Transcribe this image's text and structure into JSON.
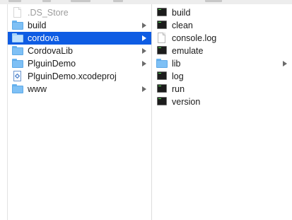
{
  "columns": {
    "parent": {
      "items": [
        {
          "label": ".DS_Store",
          "icon": "document-icon",
          "kind": "file",
          "dimmed": true
        },
        {
          "label": "build",
          "icon": "folder-icon",
          "kind": "folder"
        },
        {
          "label": "cordova",
          "icon": "folder-icon",
          "kind": "folder",
          "selected": true
        },
        {
          "label": "CordovaLib",
          "icon": "folder-icon",
          "kind": "folder"
        },
        {
          "label": "PlguinDemo",
          "icon": "folder-icon",
          "kind": "folder"
        },
        {
          "label": "PlguinDemo.xcodeproj",
          "icon": "xcodeproj-icon",
          "kind": "file"
        },
        {
          "label": "www",
          "icon": "folder-icon",
          "kind": "folder"
        }
      ]
    },
    "contents": {
      "items": [
        {
          "label": "build",
          "icon": "terminal-executable-icon",
          "kind": "file"
        },
        {
          "label": "clean",
          "icon": "terminal-executable-icon",
          "kind": "file"
        },
        {
          "label": "console.log",
          "icon": "document-icon",
          "kind": "file"
        },
        {
          "label": "emulate",
          "icon": "terminal-executable-icon",
          "kind": "file"
        },
        {
          "label": "lib",
          "icon": "folder-icon",
          "kind": "folder"
        },
        {
          "label": "log",
          "icon": "terminal-executable-icon",
          "kind": "file"
        },
        {
          "label": "run",
          "icon": "terminal-executable-icon",
          "kind": "file"
        },
        {
          "label": "version",
          "icon": "terminal-executable-icon",
          "kind": "file"
        }
      ]
    }
  },
  "colors": {
    "selection": "#0e5ce3",
    "folder": "#7ec0f5",
    "text": "#1a1a1a",
    "dimmed_text": "#9c9c9c"
  }
}
